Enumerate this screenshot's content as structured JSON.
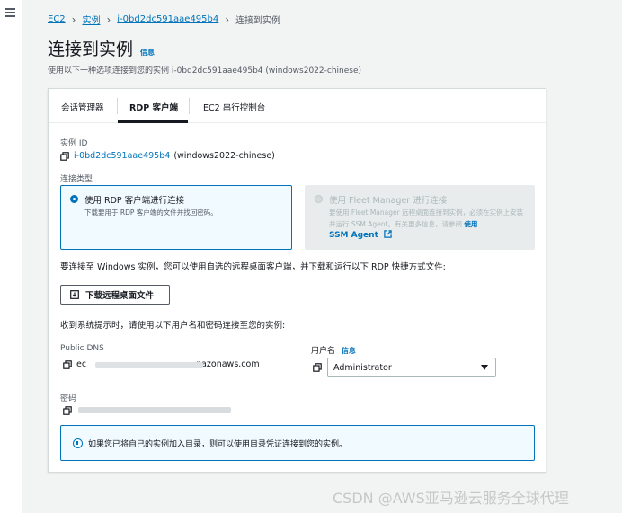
{
  "breadcrumb": {
    "ec2": "EC2",
    "instances": "实例",
    "instance_id": "i-0bd2dc591aae495b4",
    "current": "连接到实例"
  },
  "header": {
    "title": "连接到实例",
    "info": "信息",
    "description": "使用以下一种选项连接到您的实例 i-0bd2dc591aae495b4 (windows2022-chinese)"
  },
  "tabs": [
    {
      "label": "会话管理器",
      "active": false
    },
    {
      "label": "RDP 客户端",
      "active": true
    },
    {
      "label": "EC2 串行控制台",
      "active": false
    }
  ],
  "instance": {
    "label": "实例 ID",
    "id": "i-0bd2dc591aae495b4",
    "name": "(windows2022-chinese)"
  },
  "connection_type": {
    "label": "连接类型",
    "rdp": {
      "title": "使用 RDP 客户端进行连接",
      "desc": "下载要用于 RDP 客户端的文件并找回密码。",
      "selected": true
    },
    "fleet": {
      "title": "使用 Fleet Manager 进行连接",
      "desc": "要使用 Fleet Manager 远程桌面连接到实例，必须在实例上安装并运行 SSM Agent。有关更多信息，请参阅",
      "desc_link": "使用",
      "link": "SSM Agent",
      "disabled": true
    }
  },
  "instructions": {
    "rdp_text": "要连接至 Windows 实例，您可以使用自选的远程桌面客户端，并下载和运行以下 RDP 快捷方式文件:",
    "download_button": "下载远程桌面文件",
    "prompt_text": "收到系统提示时，请使用以下用户名和密码连接至您的实例:"
  },
  "dns": {
    "label": "Public DNS",
    "prefix": "ec",
    "suffix": "nazonaws.com"
  },
  "username": {
    "label": "用户名",
    "info": "信息",
    "selected": "Administrator"
  },
  "password": {
    "label": "密码"
  },
  "alert": {
    "text": "如果您已将自己的实例加入目录，则可以使用目录凭证连接到您的实例。"
  },
  "watermark": "CSDN @AWS亚马逊云服务全球代理",
  "colors": {
    "link": "#0073bb",
    "selected_bg": "#f1faff",
    "disabled_bg": "#e9ecec"
  }
}
